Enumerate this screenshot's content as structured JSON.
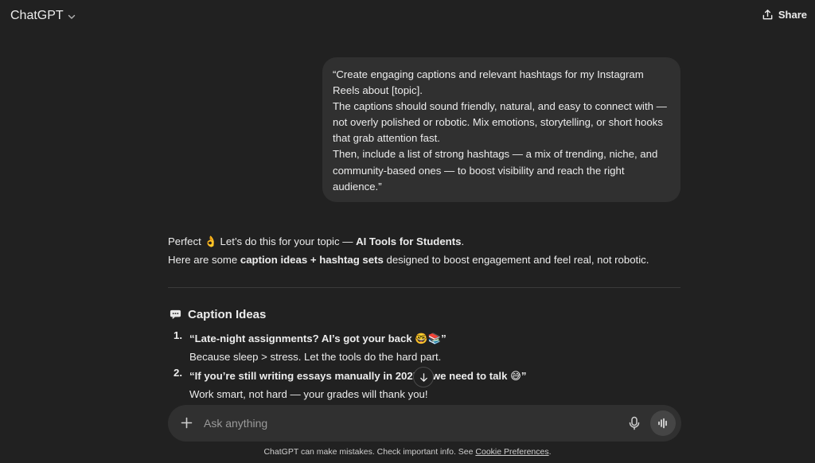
{
  "header": {
    "app_title": "ChatGPT",
    "share_label": "Share"
  },
  "user_message": {
    "lines": [
      "“Create engaging captions and relevant hashtags for my Instagram Reels about [topic].",
      "The captions should sound friendly, natural, and easy to connect with — not overly polished or robotic. Mix emotions, storytelling, or short hooks that grab attention fast.",
      "Then, include a list of strong hashtags — a mix of trending, niche, and community-based ones — to boost visibility and reach the right audience.”"
    ]
  },
  "assistant": {
    "line1_prefix": "Perfect 👌 Let’s do this for your topic — ",
    "line1_bold": "AI Tools for Students",
    "line1_suffix": ".",
    "line2_prefix": "Here are some ",
    "line2_bold": "caption ideas + hashtag sets",
    "line2_suffix": " designed to boost engagement and feel real, not robotic.",
    "section_heading": "Caption Ideas",
    "section_icon": "speech-bubble-icon",
    "captions": [
      {
        "number": "1.",
        "caption": "“Late-night assignments? AI’s got your back 🤓📚”",
        "subtext": "Because sleep > stress. Let the tools do the hard part."
      },
      {
        "number": "2.",
        "caption": "“If you’re still writing essays manually in 2025… we need to talk 😅”",
        "subtext": "Work smart, not hard — your grades will thank you!"
      }
    ]
  },
  "composer": {
    "placeholder": "Ask anything"
  },
  "footer": {
    "disclaimer_text": "ChatGPT can make mistakes. Check important info. See ",
    "link_text": "Cookie Preferences",
    "end": "."
  },
  "colors": {
    "background": "#212121",
    "bubble": "#303030",
    "text": "#ececec",
    "muted": "#9a9a9a"
  }
}
